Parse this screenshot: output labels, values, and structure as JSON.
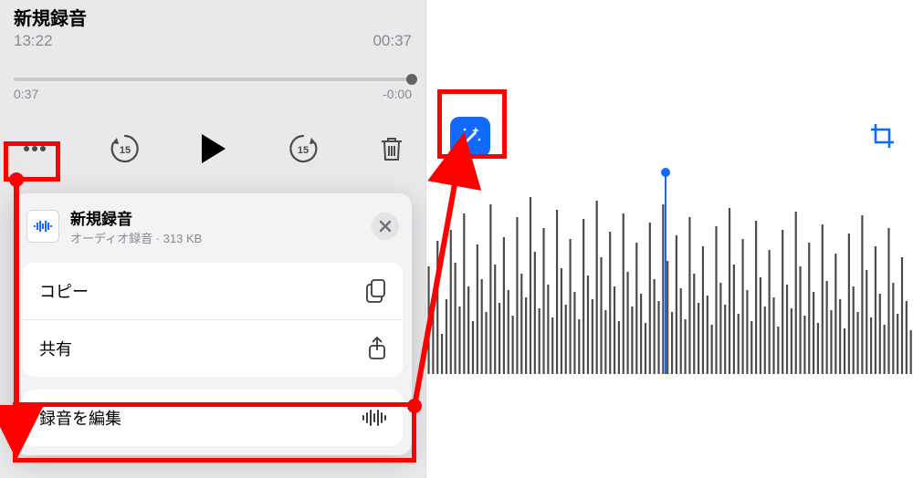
{
  "left": {
    "title": "新規録音",
    "time_label": "13:22",
    "duration_label": "00:37",
    "scrub_start": "0:37",
    "scrub_end": "-0:00"
  },
  "sheet": {
    "file_name": "新規録音",
    "file_subtitle": "オーディオ録音 · 313 KB",
    "action_copy": "コピー",
    "action_share": "共有",
    "action_edit": "録音を編集"
  },
  "right": {
    "playhead_fraction": 0.49
  },
  "icons": {
    "skip_back_label": "15",
    "skip_fwd_label": "15"
  },
  "waveform_heights": [
    118,
    66,
    146,
    44,
    82,
    158,
    122,
    74,
    176,
    96,
    58,
    142,
    104,
    68,
    186,
    120,
    78,
    150,
    92,
    64,
    172,
    110,
    84,
    194,
    134,
    72,
    160,
    98,
    62,
    180,
    116,
    76,
    148,
    90,
    60,
    170,
    108,
    82,
    190,
    128,
    70,
    156,
    96,
    58,
    176,
    112,
    74,
    144,
    88,
    56,
    166,
    104,
    80,
    186,
    124,
    68,
    152,
    94,
    60,
    172,
    110,
    78,
    140,
    86,
    54,
    162,
    100,
    76,
    182,
    120,
    66,
    148,
    92,
    58,
    168,
    106,
    74,
    136,
    84,
    52,
    158,
    98,
    72,
    178,
    118,
    64,
    144,
    90,
    56,
    164,
    102,
    70,
    132,
    82,
    50,
    154,
    96,
    68,
    174,
    114,
    62,
    140,
    88,
    54,
    160,
    100,
    66,
    128,
    80,
    48
  ]
}
